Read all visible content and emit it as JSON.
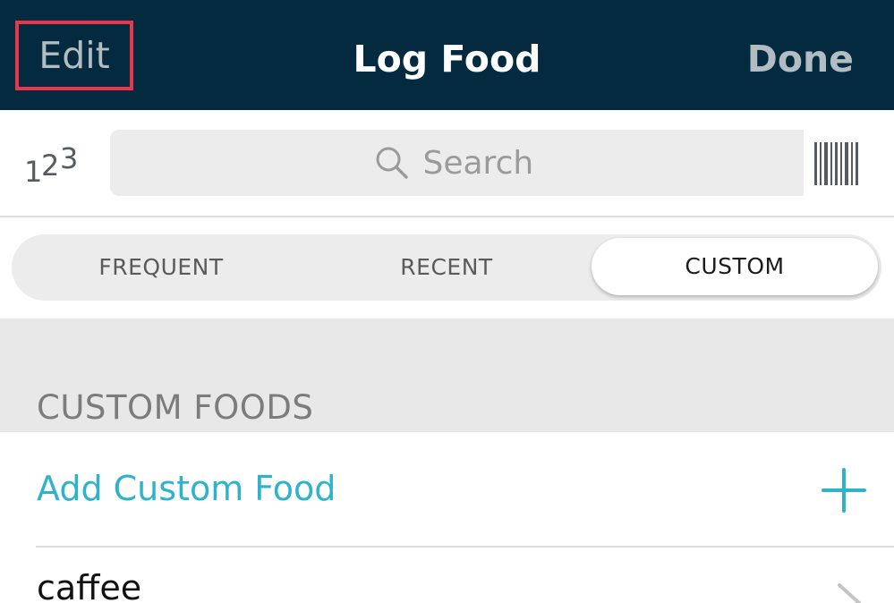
{
  "header": {
    "edit_label": "Edit",
    "title": "Log Food",
    "done_label": "Done",
    "background_color": "#032a3f",
    "highlight_color": "#e8364d"
  },
  "search": {
    "placeholder": "Search",
    "number_icon": "quick-calories-123-icon",
    "search_icon": "magnifier-icon",
    "barcode_icon": "barcode-icon"
  },
  "tabs": [
    {
      "label": "FREQUENT",
      "selected": false
    },
    {
      "label": "RECENT",
      "selected": false
    },
    {
      "label": "CUSTOM",
      "selected": true
    }
  ],
  "section": {
    "title": "CUSTOM FOODS"
  },
  "list": {
    "add_label": "Add Custom Food",
    "add_icon": "plus-icon",
    "accent_color": "#2fb3cd",
    "items": [
      {
        "label": "caffee"
      }
    ]
  }
}
